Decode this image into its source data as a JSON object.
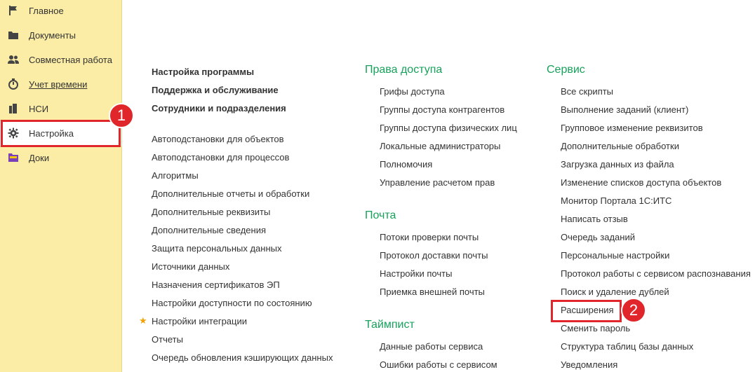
{
  "sidebar": {
    "items": [
      {
        "label": "Главное",
        "icon": "flag-icon"
      },
      {
        "label": "Документы",
        "icon": "folder-icon"
      },
      {
        "label": "Совместная работа",
        "icon": "users-icon"
      },
      {
        "label": "Учет времени",
        "icon": "timer-icon"
      },
      {
        "label": "НСИ",
        "icon": "books-icon"
      },
      {
        "label": "Настройка",
        "icon": "gear-icon"
      },
      {
        "label": "Доки",
        "icon": "folder-color-icon"
      }
    ]
  },
  "annotations": {
    "badge1": "1",
    "badge2": "2"
  },
  "col1": {
    "bold_links": [
      "Настройка программы",
      "Поддержка и обслуживание",
      "Сотрудники и подразделения"
    ],
    "links": [
      "Автоподстановки для объектов",
      "Автоподстановки для процессов",
      "Алгоритмы",
      "Дополнительные отчеты и обработки",
      "Дополнительные реквизиты",
      "Дополнительные сведения",
      "Защита персональных данных",
      "Источники данных",
      "Назначения сертификатов ЭП",
      "Настройки доступности по состоянию",
      "Настройки интеграции",
      "Отчеты",
      "Очередь обновления кэширующих данных"
    ]
  },
  "col2": {
    "sections": [
      {
        "title": "Права доступа",
        "links": [
          "Грифы доступа",
          "Группы доступа контрагентов",
          "Группы доступа физических лиц",
          "Локальные администраторы",
          "Полномочия",
          "Управление расчетом прав"
        ]
      },
      {
        "title": "Почта",
        "links": [
          "Потоки проверки почты",
          "Протокол доставки почты",
          "Настройки почты",
          "Приемка внешней почты"
        ]
      },
      {
        "title": "Таймпист",
        "links": [
          "Данные работы сервиса",
          "Ошибки работы с сервисом"
        ]
      }
    ]
  },
  "col3": {
    "title": "Сервис",
    "links": [
      "Все скрипты",
      "Выполнение заданий (клиент)",
      "Групповое изменение реквизитов",
      "Дополнительные обработки",
      "Загрузка данных из файла",
      "Изменение списков доступа объектов",
      "Монитор Портала 1С:ИТС",
      "Написать отзыв",
      "Очередь заданий",
      "Персональные настройки",
      "Протокол работы с сервисом распознавания",
      "Поиск и удаление дублей",
      "Расширения",
      "Сменить пароль",
      "Структура таблиц базы данных",
      "Уведомления"
    ]
  },
  "colors": {
    "accent": "#16a25a",
    "sidebar_bg": "#fbeda5",
    "highlight": "#e0262b",
    "star": "#f2a100"
  }
}
